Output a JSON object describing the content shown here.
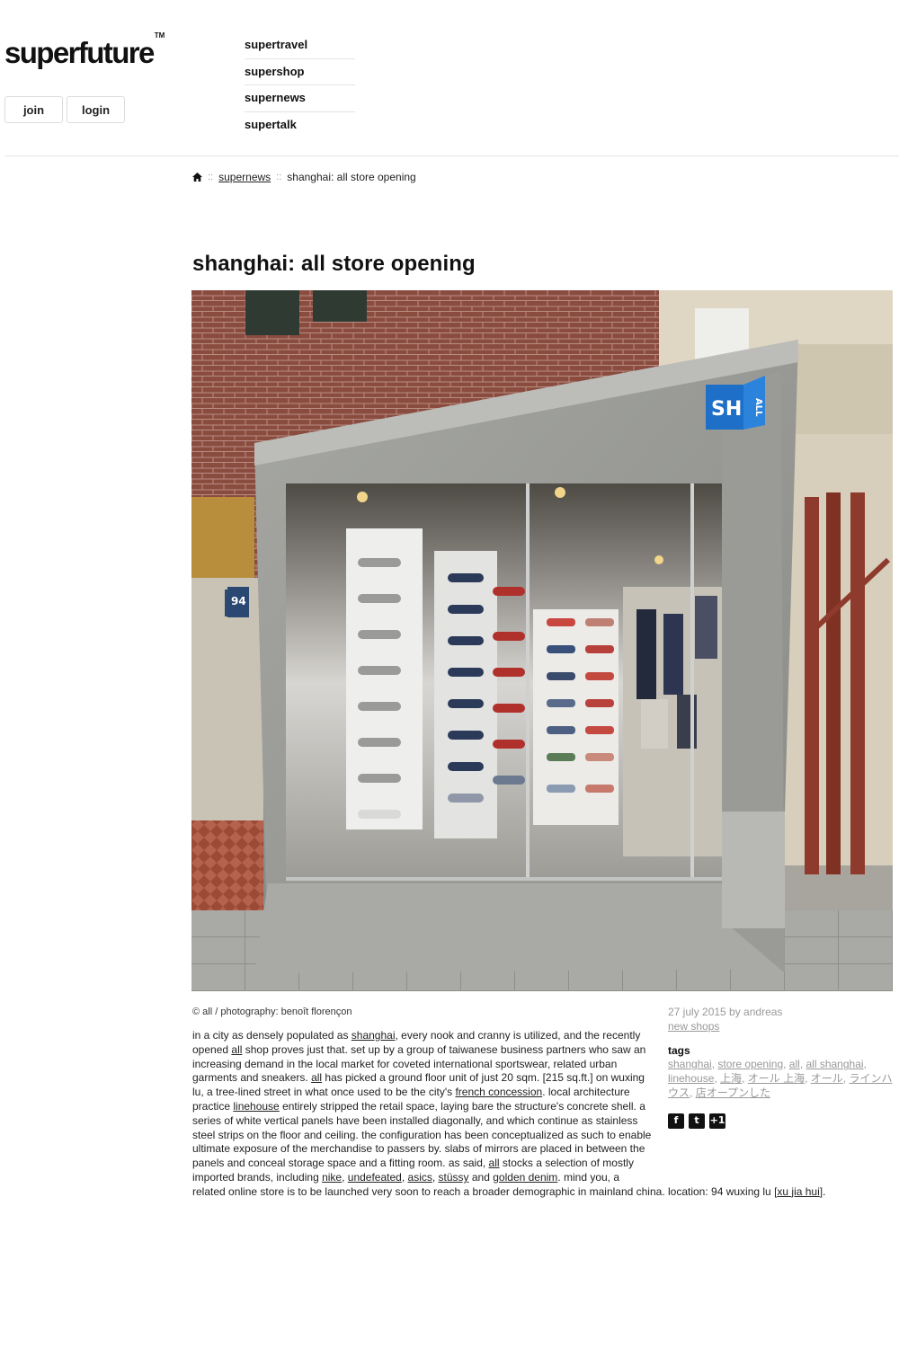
{
  "brand": {
    "name": "superfuture",
    "tm": "TM"
  },
  "auth": {
    "join": "join",
    "login": "login"
  },
  "nav": [
    "supertravel",
    "supershop",
    "supernews",
    "supertalk"
  ],
  "breadcrumb": {
    "sep": "::",
    "section": "supernews",
    "current": "shanghai: all store opening"
  },
  "article": {
    "title": "shanghai: all store opening",
    "photo_alt": "storefront of all shop on wuxing lu with sneaker wall behind glass",
    "sign_text": "SH",
    "sign_side": "ALL",
    "house_number": "94",
    "credit": "© all / photography: benoît florençon",
    "body": [
      {
        "t": "in a city as densely populated as "
      },
      {
        "l": "shanghai"
      },
      {
        "t": ", every nook and cranny is utilized, and the recently opened "
      },
      {
        "l": "all"
      },
      {
        "t": " shop proves just that. set up by a group of taiwanese business partners who saw an increasing demand in the local market for coveted international sportswear, related urban garments and sneakers. "
      },
      {
        "l": "all"
      },
      {
        "t": " has picked a ground floor unit of just 20 sqm. [215 sq.ft.] on wuxing lu, a tree-lined street in what once used to be the city's "
      },
      {
        "l": "french concession"
      },
      {
        "t": ". local architecture practice "
      },
      {
        "l": "linehouse"
      },
      {
        "t": " entirely stripped the retail space, laying bare the structure's concrete shell. a series of white vertical panels have been installed diagonally, and which continue as stainless steel strips on the floor and ceiling. the configuration has been conceptualized as such to enable ultimate exposure of the merchandise to passers by. slabs of mirrors are placed in between the panels and conceal storage space and a fitting room. as said, "
      },
      {
        "l": "all"
      },
      {
        "t": " stocks a selection of mostly imported brands, including "
      },
      {
        "l": "nike"
      },
      {
        "t": ", "
      },
      {
        "l": "undefeated"
      },
      {
        "t": ", "
      },
      {
        "l": "asics"
      },
      {
        "t": ", "
      },
      {
        "l": "stüssy"
      },
      {
        "t": " and "
      },
      {
        "l": "golden denim"
      },
      {
        "t": ". mind you, a related online store is to be launched very soon to reach a broader demographic in mainland china. location: 94 wuxing lu ["
      },
      {
        "l": "xu jia hui"
      },
      {
        "t": "]."
      }
    ]
  },
  "meta": {
    "date_by": "27 july 2015 by andreas",
    "category": "new shops",
    "tags_heading": "tags",
    "tags": [
      "shanghai",
      "store opening",
      "all",
      "all shanghai",
      "linehouse",
      "上海",
      "オール 上海",
      "オール",
      "ラインハウス",
      "店オープンした"
    ],
    "share": [
      {
        "icon": "facebook-icon",
        "glyph": "f"
      },
      {
        "icon": "twitter-icon",
        "glyph": "t"
      },
      {
        "icon": "googleplus-icon",
        "glyph": "+1"
      }
    ]
  },
  "colors": {
    "sign_blue": "#1e6fc8",
    "muted_text": "#999999",
    "pipe_red": "#8e3a2c"
  }
}
